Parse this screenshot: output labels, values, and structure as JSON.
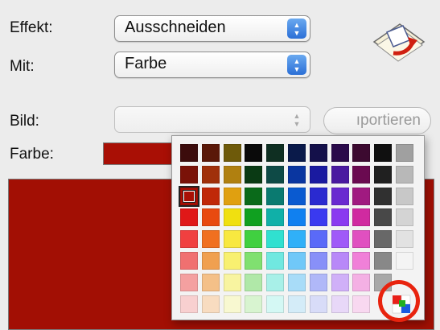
{
  "effekt": {
    "label": "Effekt:",
    "value": "Ausschneiden"
  },
  "mit": {
    "label": "Mit:",
    "value": "Farbe"
  },
  "bild": {
    "label": "Bild:",
    "value": "",
    "import_button": "ıportieren"
  },
  "farbe": {
    "label": "Farbe:",
    "color": "#a90f05"
  },
  "preview_color": "#a20f04",
  "palette": {
    "selected": {
      "row": 2,
      "col": 0
    },
    "rows": [
      [
        "#3c0c0c",
        "#5a1808",
        "#6e5a0a",
        "#0a0a0a",
        "#0f2f22",
        "#0a1a4a",
        "#14104a",
        "#2a0a4a",
        "#3c0a30",
        "#101010",
        "#a0a0a0"
      ],
      [
        "#7a1208",
        "#a0300a",
        "#b08010",
        "#0a3a14",
        "#0e4a46",
        "#0a36a0",
        "#1a1aa0",
        "#4a1aa0",
        "#6a0a50",
        "#202020",
        "#b8b8b8"
      ],
      [
        "#a90f05",
        "#c02808",
        "#e0a010",
        "#0a6a1a",
        "#0a7a70",
        "#0a5ad0",
        "#2a2ad0",
        "#6a2ad0",
        "#a01a80",
        "#303030",
        "#c8c8c8"
      ],
      [
        "#e01818",
        "#e84a10",
        "#f0e010",
        "#10a020",
        "#10b0a8",
        "#1080f0",
        "#3a3af0",
        "#8a3af0",
        "#d02aa0",
        "#484848",
        "#d4d4d4"
      ],
      [
        "#f04040",
        "#f07020",
        "#f8e840",
        "#40d040",
        "#30e0d0",
        "#30b0f8",
        "#5a6af8",
        "#a05af8",
        "#e050c0",
        "#686868",
        "#e2e2e2"
      ],
      [
        "#f07070",
        "#f0a050",
        "#f8f070",
        "#80e070",
        "#70e8e0",
        "#70c8f8",
        "#8890f8",
        "#b888f8",
        "#f080d8",
        "#888888",
        "#f4f4f4"
      ],
      [
        "#f4a0a0",
        "#f4c088",
        "#f8f4a0",
        "#b0e8a8",
        "#a8f0e8",
        "#a8dcf8",
        "#b0b8f8",
        "#d0b0f8",
        "#f4b0e4",
        "#a8a8a8"
      ],
      [
        "#f8d0d0",
        "#f8dcc0",
        "#f8f8d0",
        "#d8f4d0",
        "#d4f8f4",
        "#d4ecf8",
        "#d8dcf8",
        "#e8d8f8",
        "#f8d8f0"
      ]
    ]
  },
  "icons": {
    "effekt_arrows": "up-down-arrows-icon",
    "mit_arrows": "up-down-arrows-icon",
    "bild_arrows": "up-down-arrows-icon",
    "app": "photo-effect-icon",
    "more_colors": "color-picker-icon"
  },
  "accent_colors": {
    "highlight": "#e8230e",
    "popup_arrows": "#2b6fd6"
  }
}
